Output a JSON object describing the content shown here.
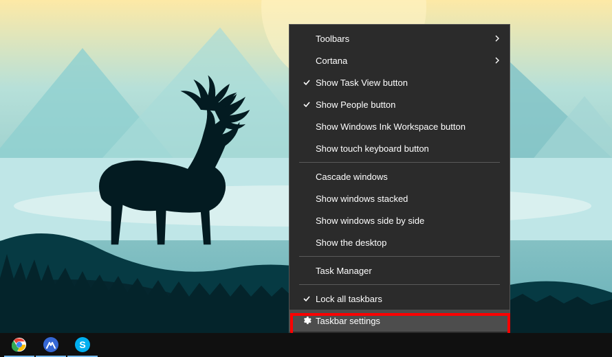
{
  "menu": {
    "groups": [
      [
        {
          "key": "toolbars",
          "label": "Toolbars",
          "submenu": true
        },
        {
          "key": "cortana",
          "label": "Cortana",
          "submenu": true
        },
        {
          "key": "show-task-view",
          "label": "Show Task View button",
          "checked": true
        },
        {
          "key": "show-people",
          "label": "Show People button",
          "checked": true
        },
        {
          "key": "show-ink",
          "label": "Show Windows Ink Workspace button"
        },
        {
          "key": "show-touch-kbd",
          "label": "Show touch keyboard button"
        }
      ],
      [
        {
          "key": "cascade",
          "label": "Cascade windows"
        },
        {
          "key": "stacked",
          "label": "Show windows stacked"
        },
        {
          "key": "side-by-side",
          "label": "Show windows side by side"
        },
        {
          "key": "show-desktop",
          "label": "Show the desktop"
        }
      ],
      [
        {
          "key": "task-manager",
          "label": "Task Manager"
        }
      ],
      [
        {
          "key": "lock-taskbars",
          "label": "Lock all taskbars",
          "checked": true
        },
        {
          "key": "taskbar-settings",
          "label": "Taskbar settings",
          "gear": true,
          "highlighted": true
        }
      ]
    ]
  },
  "taskbar": {
    "items": [
      {
        "key": "chrome",
        "name": "chrome-icon",
        "running": true
      },
      {
        "key": "nordvpn",
        "name": "nordvpn-icon",
        "running": true
      },
      {
        "key": "skype",
        "name": "skype-icon",
        "running": true
      }
    ]
  },
  "colors": {
    "menu_bg": "#2b2b2b",
    "menu_hover": "#4d4d4d",
    "taskbar_bg": "#101010",
    "highlight_red": "#ff0000"
  }
}
